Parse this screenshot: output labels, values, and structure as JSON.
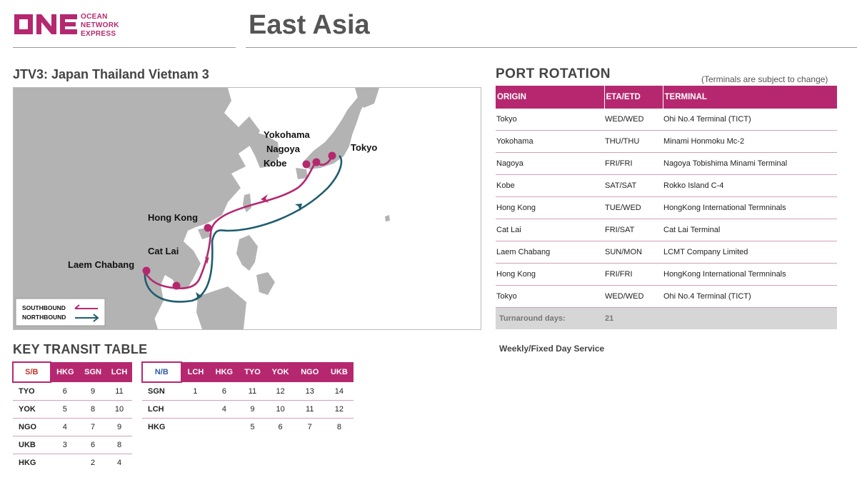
{
  "brand": {
    "mark": "ONE",
    "lines": [
      "OCEAN",
      "NETWORK",
      "EXPRESS"
    ],
    "color": "#b5286f"
  },
  "page_title": "East Asia",
  "service_title": "JTV3: Japan Thailand Vietnam 3",
  "map": {
    "ports": {
      "yokohama": "Yokohama",
      "nagoya": "Nagoya",
      "kobe": "Kobe",
      "tokyo": "Tokyo",
      "hong_kong": "Hong Kong",
      "cat_lai": "Cat Lai",
      "laem_chabang": "Laem Chabang"
    },
    "legend": {
      "southbound": "SOUTHBOUND",
      "northbound": "NORTHBOUND"
    },
    "colors": {
      "southbound": "#b5286f",
      "northbound": "#1f5d6e",
      "land": "#b3b3b3"
    }
  },
  "port_rotation": {
    "title": "PORT ROTATION",
    "note": "(Terminals are subject to change)",
    "headers": [
      "ORIGIN",
      "ETA/ETD",
      "TERMINAL"
    ],
    "rows": [
      [
        "Tokyo",
        "WED/WED",
        "Ohi No.4 Terminal (TICT)"
      ],
      [
        "Yokohama",
        "THU/THU",
        "Minami Honmoku Mc-2"
      ],
      [
        "Nagoya",
        "FRI/FRI",
        "Nagoya Tobishima Minami Terminal"
      ],
      [
        "Kobe",
        "SAT/SAT",
        "Rokko Island C-4"
      ],
      [
        "Hong Kong",
        "TUE/WED",
        "HongKong International Termninals"
      ],
      [
        "Cat Lai",
        "FRI/SAT",
        "Cat Lai Terminal"
      ],
      [
        "Laem Chabang",
        "SUN/MON",
        "LCMT Company Limited"
      ],
      [
        "Hong Kong",
        "FRI/FRI",
        "HongKong International Termninals"
      ],
      [
        "Tokyo",
        "WED/WED",
        "Ohi No.4 Terminal (TICT)"
      ]
    ],
    "summary": {
      "label": "Turnaround days:",
      "value": "21"
    },
    "service_note": "Weekly/Fixed Day Service"
  },
  "transit": {
    "title": "KEY TRANSIT TABLE",
    "southbound": {
      "corner": "S/B",
      "columns": [
        "HKG",
        "SGN",
        "LCH"
      ],
      "rows": [
        {
          "port": "TYO",
          "values": [
            "6",
            "9",
            "11"
          ]
        },
        {
          "port": "YOK",
          "values": [
            "5",
            "8",
            "10"
          ]
        },
        {
          "port": "NGO",
          "values": [
            "4",
            "7",
            "9"
          ]
        },
        {
          "port": "UKB",
          "values": [
            "3",
            "6",
            "8"
          ]
        },
        {
          "port": "HKG",
          "values": [
            "",
            "2",
            "4"
          ]
        }
      ]
    },
    "northbound": {
      "corner": "N/B",
      "columns": [
        "LCH",
        "HKG",
        "TYO",
        "YOK",
        "NGO",
        "UKB"
      ],
      "rows": [
        {
          "port": "SGN",
          "values": [
            "1",
            "6",
            "11",
            "12",
            "13",
            "14"
          ]
        },
        {
          "port": "LCH",
          "values": [
            "",
            "4",
            "9",
            "10",
            "11",
            "12"
          ]
        },
        {
          "port": "HKG",
          "values": [
            "",
            "",
            "5",
            "6",
            "7",
            "8"
          ]
        }
      ]
    }
  }
}
